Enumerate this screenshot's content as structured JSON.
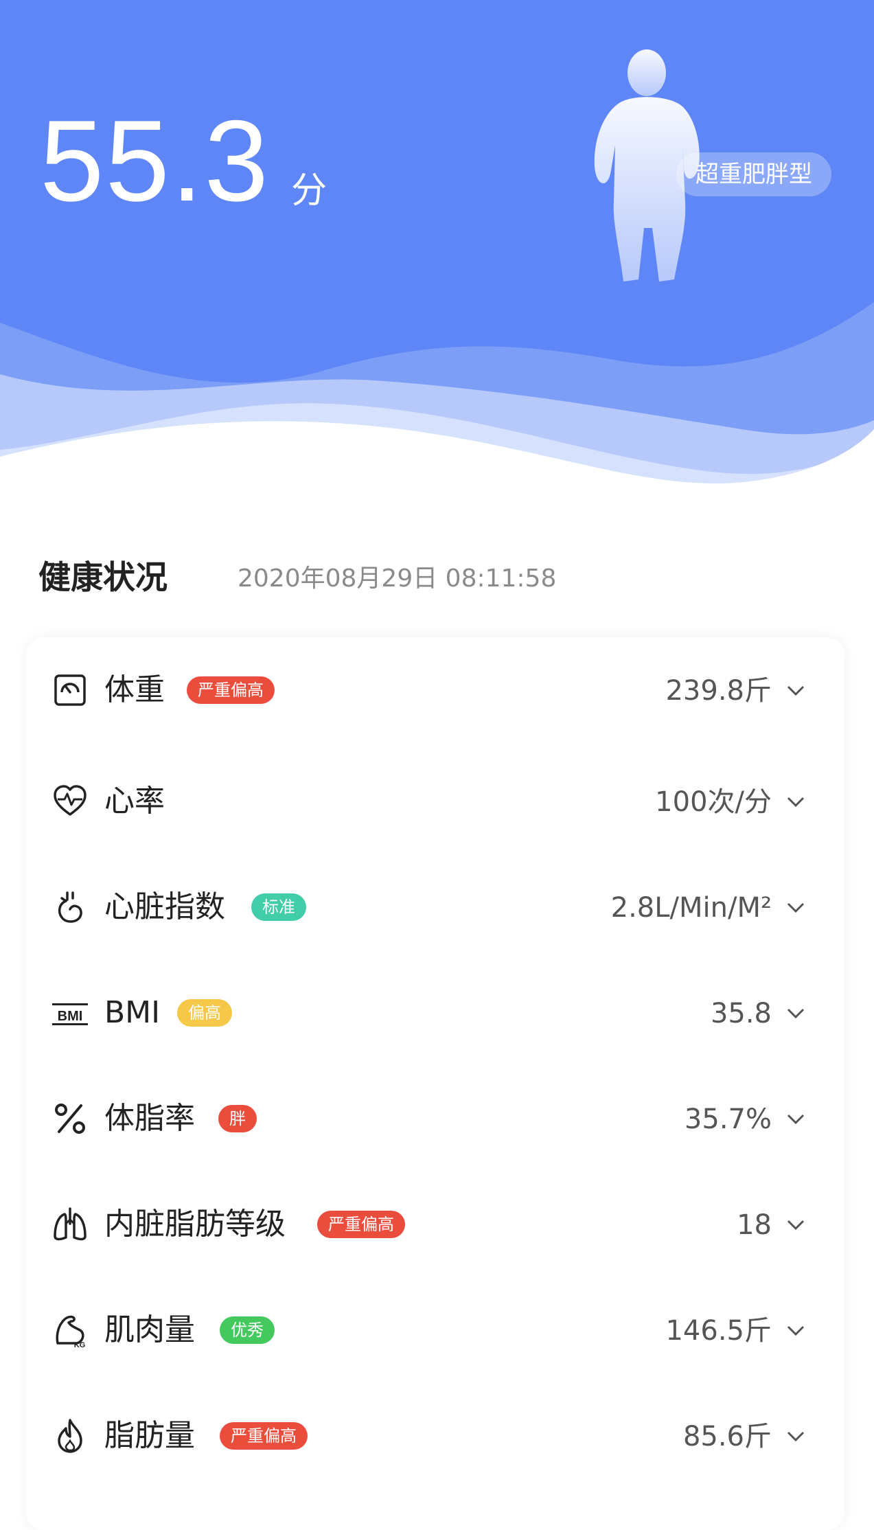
{
  "header": {
    "score": "55.3",
    "score_unit": "分",
    "body_type": "超重肥胖型",
    "bg_color": "#5f86f6"
  },
  "section": {
    "title": "健康状况",
    "timestamp": "2020年08月29日 08:11:58"
  },
  "metrics": [
    {
      "label": "体重",
      "badge": "严重偏高",
      "badge_color": "#ea4d3c",
      "value": "239.8斤",
      "icon": "scale-icon"
    },
    {
      "label": "心率",
      "badge": "",
      "value": "100次/分",
      "icon": "heart-rate-icon"
    },
    {
      "label": "心脏指数",
      "badge": "标准",
      "badge_color": "#41cda8",
      "value": "2.8L/Min/M²",
      "icon": "heart-organ-icon"
    },
    {
      "label": "BMI",
      "badge": "偏高",
      "badge_color": "#f5c84a",
      "value": "35.8",
      "icon": "bmi-icon"
    },
    {
      "label": "体脂率",
      "badge": "胖",
      "badge_color": "#ea4d3c",
      "value": "35.7%",
      "icon": "percent-icon"
    },
    {
      "label": "内脏脂肪等级",
      "badge": "严重偏高",
      "badge_color": "#ea4d3c",
      "value": "18",
      "icon": "lungs-icon"
    },
    {
      "label": "肌肉量",
      "badge": "优秀",
      "badge_color": "#44c95f",
      "value": "146.5斤",
      "icon": "muscle-icon"
    },
    {
      "label": "脂肪量",
      "badge": "严重偏高",
      "badge_color": "#ea4d3c",
      "value": "85.6斤",
      "icon": "flame-icon"
    }
  ]
}
